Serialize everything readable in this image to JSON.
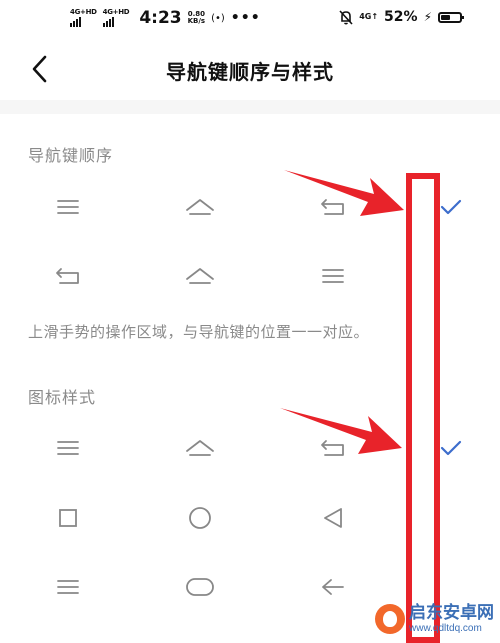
{
  "status_bar": {
    "sim1_label": "4G+HD",
    "sim2_label": "4G+HD",
    "time": "4:23",
    "speed_value": "0.80",
    "speed_unit": "KB/s",
    "hotspot_glyph": "(•)",
    "more_glyph": "•••",
    "mute_icon": "bell-off-icon",
    "network_label": "4G↑",
    "battery_percent": "52%",
    "charging_glyph": "⚡",
    "battery_level": 0.52
  },
  "header": {
    "back_icon": "chevron-left-icon",
    "title": "导航键顺序与样式"
  },
  "order_section": {
    "label": "导航键顺序",
    "options": [
      {
        "icons": [
          "menu-icon",
          "home-icon",
          "back-icon"
        ],
        "selected": true
      },
      {
        "icons": [
          "back-icon",
          "home-icon",
          "menu-icon"
        ],
        "selected": false
      }
    ]
  },
  "hint": "上滑手势的操作区域，与导航键的位置一一对应。",
  "style_section": {
    "label": "图标样式",
    "options": [
      {
        "icons": [
          "menu-icon",
          "home-icon",
          "back-icon"
        ],
        "selected": true
      },
      {
        "icons": [
          "square-icon",
          "circle-icon",
          "triangle-left-icon"
        ],
        "selected": false
      },
      {
        "icons": [
          "menu-icon",
          "pill-icon",
          "arrow-left-icon"
        ],
        "selected": false
      }
    ]
  },
  "annotations": {
    "highlight_color": "#e8232a",
    "check_color": "#3d6dcc"
  },
  "watermark": {
    "name": "启东安卓网",
    "url": "www.qdltdq.com"
  }
}
